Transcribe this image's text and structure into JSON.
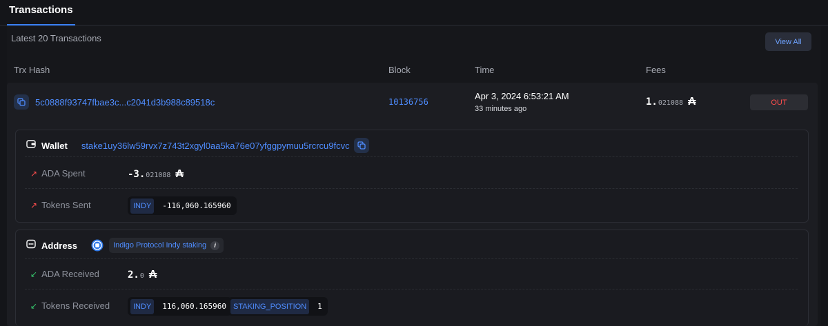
{
  "header": {
    "tab_label": "Transactions"
  },
  "section": {
    "subtitle": "Latest 20 Transactions",
    "view_all_label": "View All"
  },
  "columns": {
    "hash": "Trx Hash",
    "block": "Block",
    "time": "Time",
    "fees": "Fees"
  },
  "transaction": {
    "hash": "5c0888f93747fbae3c...c2041d3b988c89518c",
    "block": "10136756",
    "time": "Apr 3, 2024 6:53:21 AM",
    "relative_time": "33 minutes ago",
    "fee_int": "1.",
    "fee_frac": "021088",
    "ada_symbol": "₳",
    "direction": "OUT",
    "wallet": {
      "label": "Wallet",
      "address": "stake1uy36lw59rvx7z743t2xgyl0aa5ka76e07yfggpymuu5rcrcu9fcvc",
      "ada_spent_label": "ADA Spent",
      "ada_spent_int": "-3.",
      "ada_spent_frac": "021088",
      "tokens_sent_label": "Tokens Sent",
      "tokens_sent": [
        {
          "symbol": "INDY",
          "amount": "-116,060.165960"
        }
      ]
    },
    "address": {
      "label": "Address",
      "protocol_name": "Indigo Protocol Indy staking",
      "info_glyph": "i",
      "ada_received_label": "ADA Received",
      "ada_received_int": "2.",
      "ada_received_frac": "0",
      "tokens_received_label": "Tokens Received",
      "tokens_received": [
        {
          "symbol": "INDY",
          "amount": "116,060.165960"
        },
        {
          "symbol": "STAKING_POSITION",
          "amount": "1"
        }
      ]
    }
  },
  "icons": {
    "copy": "copy-icon",
    "wallet": "wallet-icon",
    "address": "address-icon",
    "protocol": "protocol-logo-icon",
    "arrow_up": "arrow-up-right-icon",
    "arrow_down": "arrow-down-left-icon"
  },
  "colors": {
    "accent": "#4f8dff",
    "out": "#ff4d4d",
    "in": "#36c46b",
    "background": "#141519"
  }
}
